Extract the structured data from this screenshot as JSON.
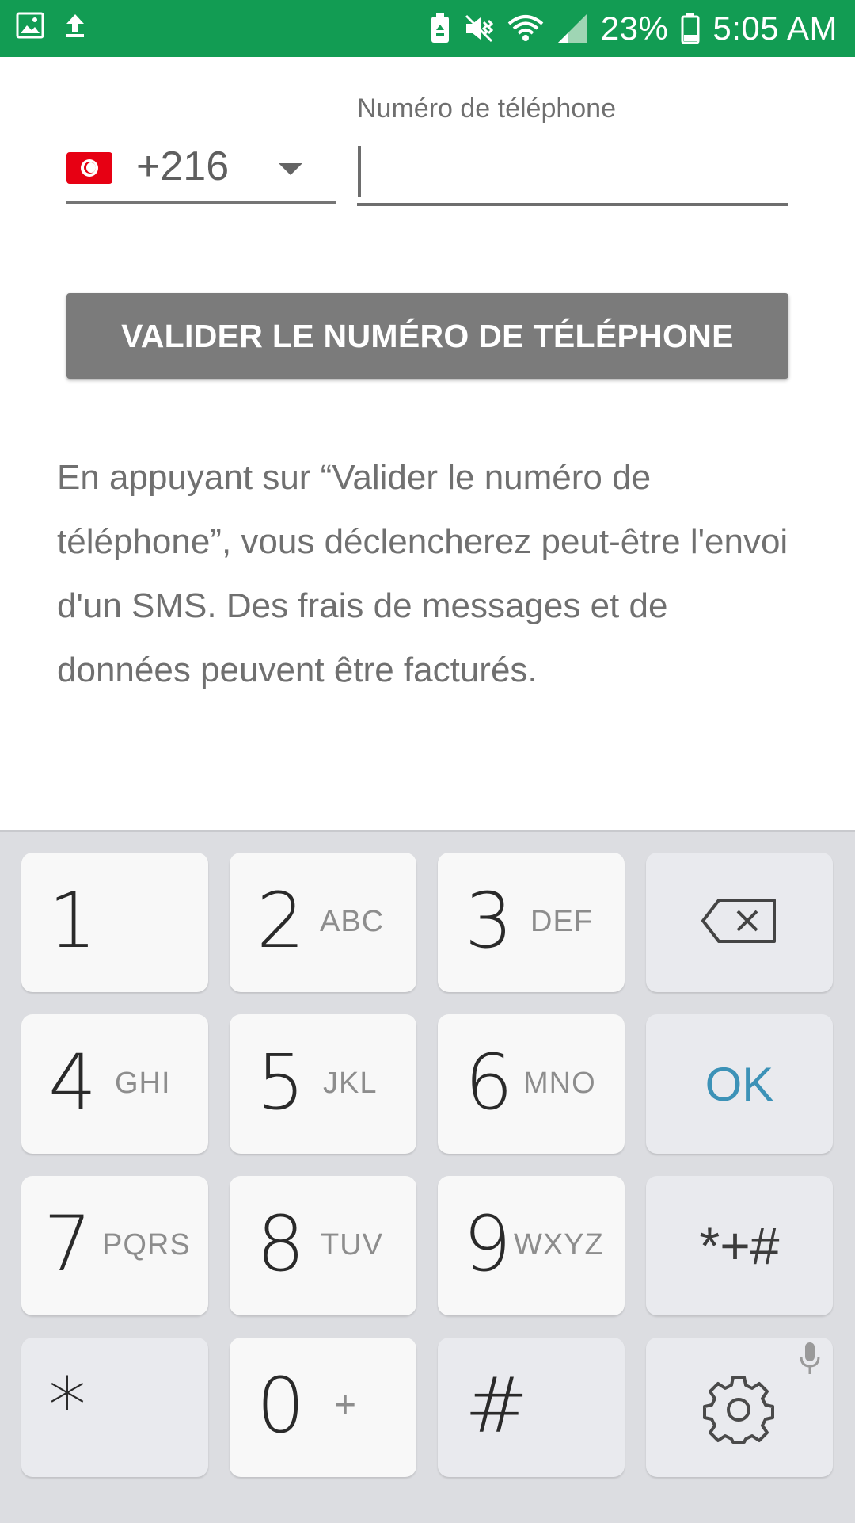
{
  "status_bar": {
    "battery_percent": "23%",
    "time": "5:05 AM",
    "background_color": "#129c53",
    "left_icons": [
      "image-icon",
      "upload-icon"
    ],
    "right_icons": [
      "battery-saver-icon",
      "vibrate-icon",
      "wifi-icon",
      "signal-icon",
      "battery-icon"
    ]
  },
  "country_selector": {
    "flag": "tunisia-flag",
    "code": "+216"
  },
  "phone_field": {
    "label": "Numéro de téléphone",
    "value": ""
  },
  "validate_button": {
    "label": "VALIDER LE NUMÉRO DE TÉLÉPHONE"
  },
  "disclaimer": "En appuyant sur “Valider le numéro de téléphone”, vous déclencherez peut-être l'envoi d'un SMS. Des frais de messages et de données peuvent être facturés.",
  "keyboard": {
    "keys": {
      "k1": {
        "num": "1",
        "letters": ""
      },
      "k2": {
        "num": "2",
        "letters": "ABC"
      },
      "k3": {
        "num": "3",
        "letters": "DEF"
      },
      "k4": {
        "num": "4",
        "letters": "GHI"
      },
      "k5": {
        "num": "5",
        "letters": "JKL"
      },
      "k6": {
        "num": "6",
        "letters": "MNO"
      },
      "k7": {
        "num": "7",
        "letters": "PQRS"
      },
      "k8": {
        "num": "8",
        "letters": "TUV"
      },
      "k9": {
        "num": "9",
        "letters": "WXYZ"
      },
      "k0": {
        "num": "0",
        "letters": "+"
      },
      "star": "*",
      "hash": "#"
    },
    "ok_label": "OK",
    "symbols_label": "*+#",
    "ok_color": "#3c92b7"
  }
}
